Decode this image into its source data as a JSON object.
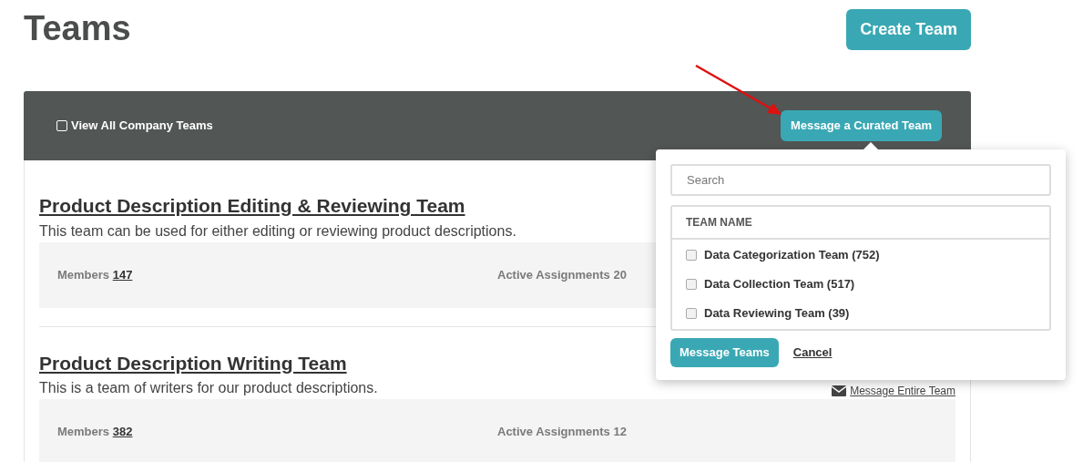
{
  "page_title": "Teams",
  "create_button": "Create Team",
  "toolbar": {
    "view_all": {
      "label": "View All Company Teams",
      "checked": false
    },
    "curated_button": "Message a Curated Team"
  },
  "teams": [
    {
      "name": "Product Description Editing & Reviewing Team",
      "description": "This team can be used for either editing or reviewing product descriptions.",
      "members_label": "Members",
      "members": "147",
      "assignments_label": "Active Assignments",
      "assignments": "20"
    },
    {
      "name": "Product Description Writing Team",
      "description": "This is a team of writers for our product descriptions.",
      "message_link": "Message Entire Team",
      "members_label": "Members",
      "members": "382",
      "assignments_label": "Active Assignments",
      "assignments": "12"
    }
  ],
  "popover": {
    "search": {
      "placeholder": "Search"
    },
    "column": "TEAM NAME",
    "items": [
      {
        "label": "Data Categorization Team (752)",
        "checked": false
      },
      {
        "label": "Data Collection Team (517)",
        "checked": false
      },
      {
        "label": "Data Reviewing Team (39)",
        "checked": false
      }
    ],
    "submit": "Message Teams",
    "cancel": "Cancel"
  }
}
